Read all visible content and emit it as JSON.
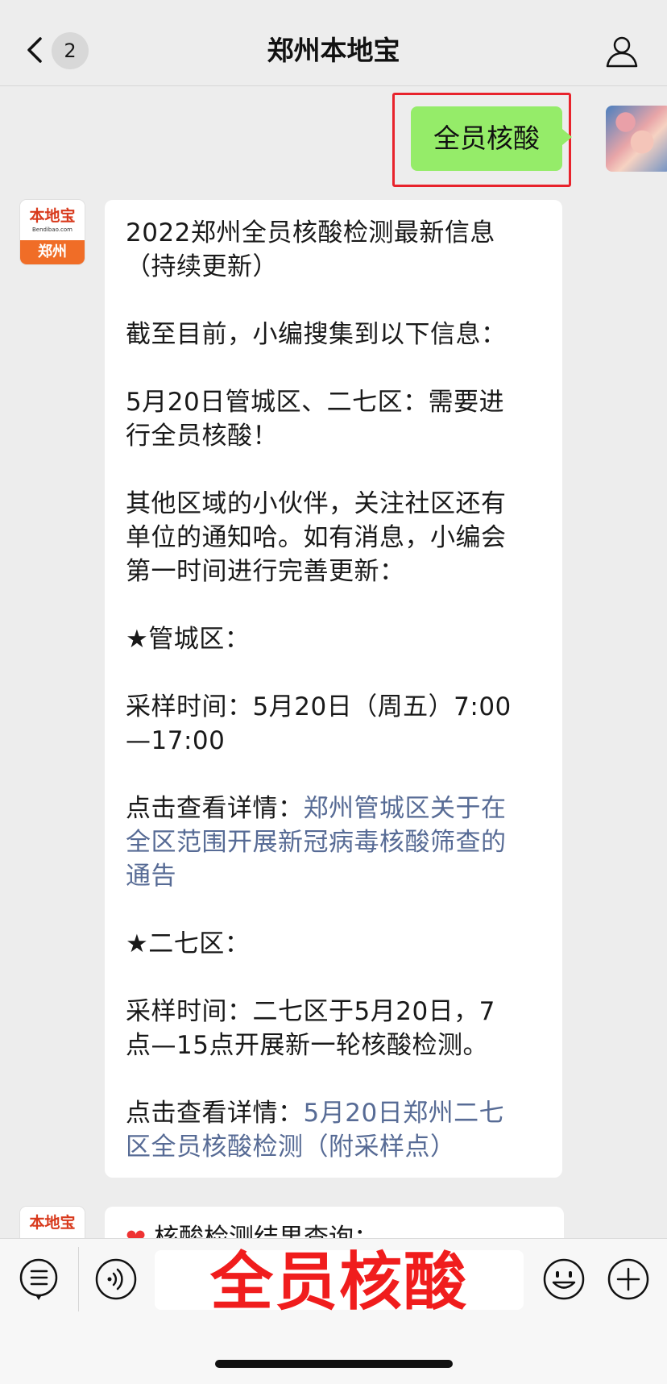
{
  "header": {
    "unread_count": "2",
    "title": "郑州本地宝"
  },
  "sent_message": {
    "text": "全员核酸",
    "highlight_color": "#e8232c"
  },
  "sender": {
    "brand_name": "本地宝",
    "brand_url": "Bendibao.com",
    "brand_city": "郑州"
  },
  "message": {
    "title_line1": "2022郑州全员核酸检测最新信息",
    "title_line2": "（持续更新）",
    "intro": "截至目前，小编搜集到以下信息：",
    "notice_line1": "5月20日管城区、二七区：需要进",
    "notice_line2": "行全员核酸！",
    "others_line1": "其他区域的小伙伴，关注社区还有",
    "others_line2": "单位的通知哈。如有消息，小编会",
    "others_line3": "第一时间进行完善更新：",
    "district1_heading": "★管城区：",
    "district1_time_line1": "采样时间：5月20日（周五）7:00",
    "district1_time_line2": "—17:00",
    "district1_detail_prefix": "点击查看详情：",
    "district1_link_line1": "郑州管城区关于在",
    "district1_link_line2": "全区范围开展新冠病毒核酸筛查的",
    "district1_link_line3": "通告",
    "district2_heading": "★二七区：",
    "district2_time_line1": "采样时间：二七区于5月20日，7",
    "district2_time_line2": "点—15点开展新一轮核酸检测。",
    "district2_detail_prefix": "点击查看详情：",
    "district2_link_line1": "5月20日郑州二七",
    "district2_link_line2": "区全员核酸检测（附采样点）"
  },
  "message2": {
    "partial_text": "核酸检测结果查询："
  },
  "input_bar": {
    "overlay_caption": "全员核酸",
    "overlay_color": "#f01d1d"
  },
  "colors": {
    "sent_bubble": "#95ec69",
    "link": "#576b95",
    "background": "#ededed"
  },
  "icons": [
    "back-arrow-icon",
    "person-icon",
    "menu-list-icon",
    "voice-icon",
    "emoji-icon",
    "plus-icon",
    "heart-icon"
  ]
}
